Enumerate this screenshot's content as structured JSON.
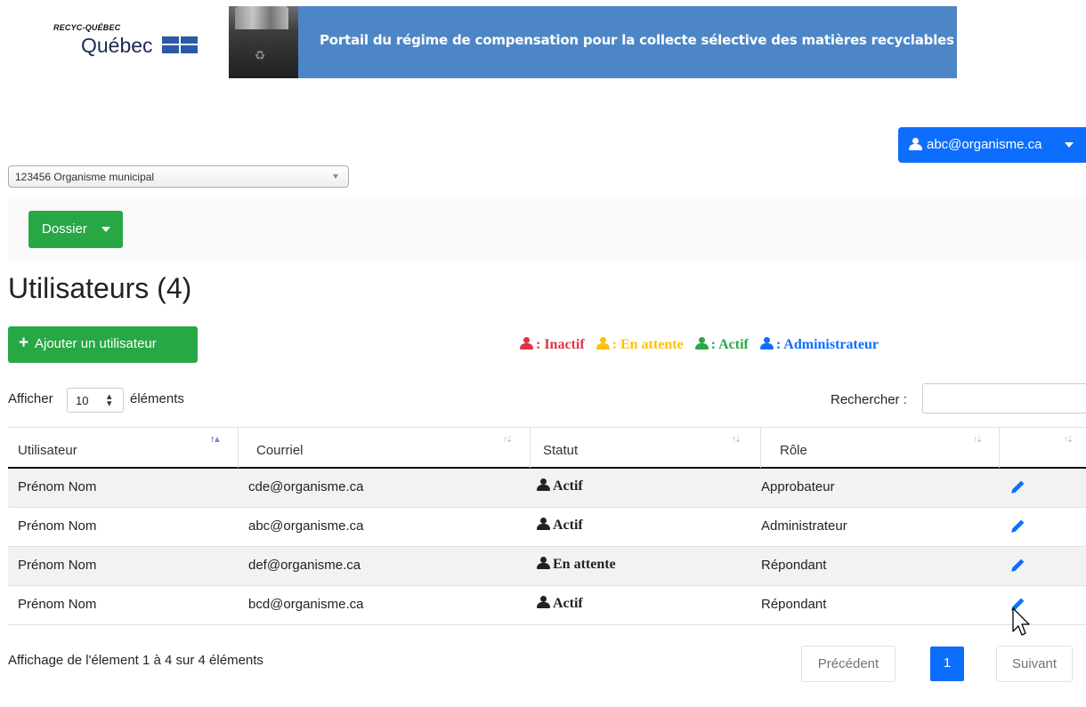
{
  "header": {
    "logo_top": "RECYC-QUÉBEC",
    "logo_main": "Québec",
    "banner_title": "Portail du régime de compensation pour la collecte sélective des matières recyclables"
  },
  "user_menu": {
    "label": "abc@organisme.ca"
  },
  "organization_select": {
    "value": "123456 Organisme municipal"
  },
  "dossier_menu": {
    "label": "Dossier"
  },
  "page": {
    "title": "Utilisateurs (4)"
  },
  "add_user": {
    "label": "Ajouter un utilisateur"
  },
  "legend": {
    "inactive": ": Inactif",
    "pending": ": En attente",
    "active": ": Actif",
    "admin": ": Administrateur"
  },
  "table_controls": {
    "show_label": "Afficher",
    "page_length": "10",
    "elements_label": "éléments",
    "search_label": "Rechercher :"
  },
  "table": {
    "columns": [
      "Utilisateur",
      "Courriel",
      "Statut",
      "Rôle"
    ],
    "rows": [
      {
        "user": "Prénom Nom",
        "email": "cde@organisme.ca",
        "status": "Actif",
        "role": "Approbateur"
      },
      {
        "user": "Prénom Nom",
        "email": "abc@organisme.ca",
        "status": "Actif",
        "role": "Administrateur"
      },
      {
        "user": "Prénom Nom",
        "email": "def@organisme.ca",
        "status": "En attente",
        "role": "Répondant"
      },
      {
        "user": "Prénom Nom",
        "email": "bcd@organisme.ca",
        "status": "Actif",
        "role": "Répondant"
      }
    ]
  },
  "pagination": {
    "info": "Affichage de l'élement 1 à 4 sur 4 éléments",
    "previous": "Précédent",
    "current": "1",
    "next": "Suivant"
  },
  "colors": {
    "primary": "#0d6efd",
    "success": "#28a745",
    "inactive": "#dc3545",
    "pending": "#ffc107",
    "banner": "#4d86c6"
  },
  "icons": [
    "user-icon",
    "plus-icon",
    "pencil-icon",
    "caret-down-icon",
    "sort-icon",
    "recycle-bin-icon",
    "quebec-flag-icon"
  ]
}
